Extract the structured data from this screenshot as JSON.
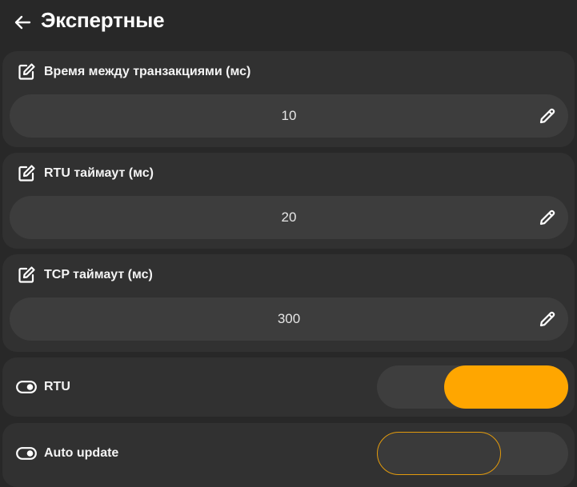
{
  "header": {
    "title": "Экспертные",
    "back_icon": "arrow-left-icon"
  },
  "settings": [
    {
      "label": "Время между транзакциями (мс)",
      "value": "10",
      "icon": "edit-square-icon",
      "edit_icon": "pencil-icon"
    },
    {
      "label": "RTU таймаут (мс)",
      "value": "20",
      "icon": "edit-square-icon",
      "edit_icon": "pencil-icon"
    },
    {
      "label": "TCP таймаут (мс)",
      "value": "300",
      "icon": "edit-square-icon",
      "edit_icon": "pencil-icon"
    }
  ],
  "toggles": [
    {
      "label": "RTU",
      "state": "on",
      "icon": "toggle-icon"
    },
    {
      "label": "Auto update",
      "state": "off",
      "icon": "toggle-icon"
    }
  ],
  "colors": {
    "background": "#282828",
    "card": "#313131",
    "field": "#3d3d3d",
    "accent": "#ffa600",
    "text": "#f2f2f2"
  }
}
